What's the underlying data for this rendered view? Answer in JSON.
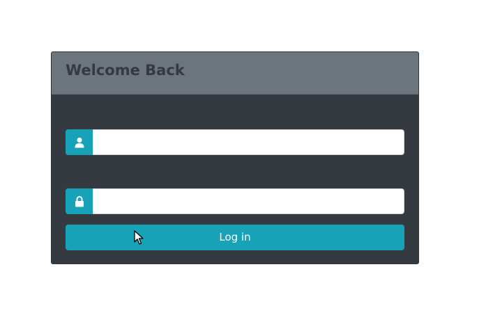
{
  "login_card": {
    "title": "Welcome Back",
    "username": {
      "icon": "user-icon",
      "value": "",
      "placeholder": ""
    },
    "password": {
      "icon": "lock-icon",
      "value": "",
      "placeholder": ""
    },
    "login_button_label": "Log in"
  },
  "colors": {
    "card_background": "#343a40",
    "header_background": "#6c757d",
    "accent": "#17a2b8",
    "title_text": "#343a40"
  }
}
